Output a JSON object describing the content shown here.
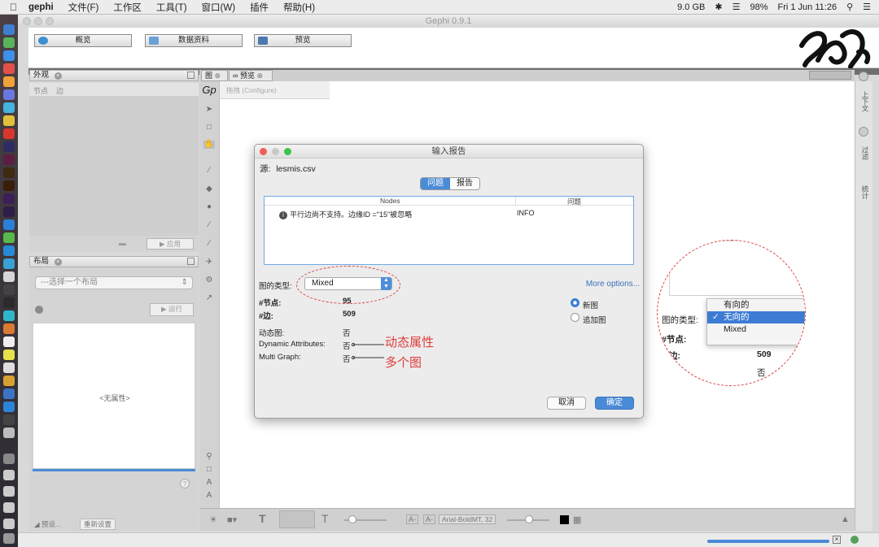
{
  "menubar": {
    "app": "gephi",
    "items": [
      "文件(F)",
      "工作区",
      "工具(T)",
      "窗口(W)",
      "插件",
      "帮助(H)"
    ],
    "memory": "9.0 GB",
    "battery": "98%",
    "clock": "Fri 1 Jun  11:26"
  },
  "window": {
    "title": "Gephi 0.9.1"
  },
  "toolbar": {
    "overview": "概览",
    "data_lab": "数据资料",
    "preview": "预览"
  },
  "appearance": {
    "title": "外观",
    "tab_nodes": "节点",
    "tab_edges": "边",
    "apply": "应用"
  },
  "layout": {
    "title": "布局",
    "select_placeholder": "---选择一个布局",
    "run": "运行",
    "empty": "<无属性>",
    "presets": "预设...",
    "reset": "重新设置"
  },
  "graph": {
    "tab_graph": "图",
    "tab_preview": "预览",
    "canvas_hint": "拖拽 (Configure)",
    "font_label": "Arial-BoldMT, 32"
  },
  "right_rail": {
    "context": "上下文",
    "filter": "过滤",
    "statistics": "统计"
  },
  "dialog": {
    "title": "输入报告",
    "source_label": "源:",
    "source_file": "lesmis.csv",
    "tab_issues": "问题",
    "tab_report": "报告",
    "col_nodes": "Nodes",
    "col_issue": "问题",
    "issue_text": "平行边尚不支持。边缘ID =\"15\"被忽略",
    "issue_level": "INFO",
    "graph_type_label": "图的类型:",
    "graph_type_value": "Mixed",
    "more_options": "More options...",
    "node_count_label": "#节点:",
    "node_count": "95",
    "edge_count_label": "#边:",
    "edge_count": "509",
    "dynamic_graph_label": "动态图:",
    "dynamic_graph_value": "否",
    "dynamic_attr_label": "Dynamic Attributes:",
    "dynamic_attr_value": "否",
    "multi_graph_label": "Multi Graph:",
    "multi_graph_value": "否",
    "radio_new": "新图",
    "radio_append": "追加图",
    "cancel": "取消",
    "ok": "确定"
  },
  "annotations": {
    "dynamic_attr": "动态属性",
    "multi_graph": "多个图"
  },
  "zoom": {
    "graph_type_label": "图的类型:",
    "nodes_label": "#节点:",
    "edges_label": "边:",
    "edges_value": "509",
    "dynamic_value": "否",
    "options": [
      "有向的",
      "无向的",
      "Mixed"
    ],
    "selected": "无向的"
  },
  "colors": {
    "accent": "#4a8bd7",
    "annotation": "#e03a3a"
  }
}
